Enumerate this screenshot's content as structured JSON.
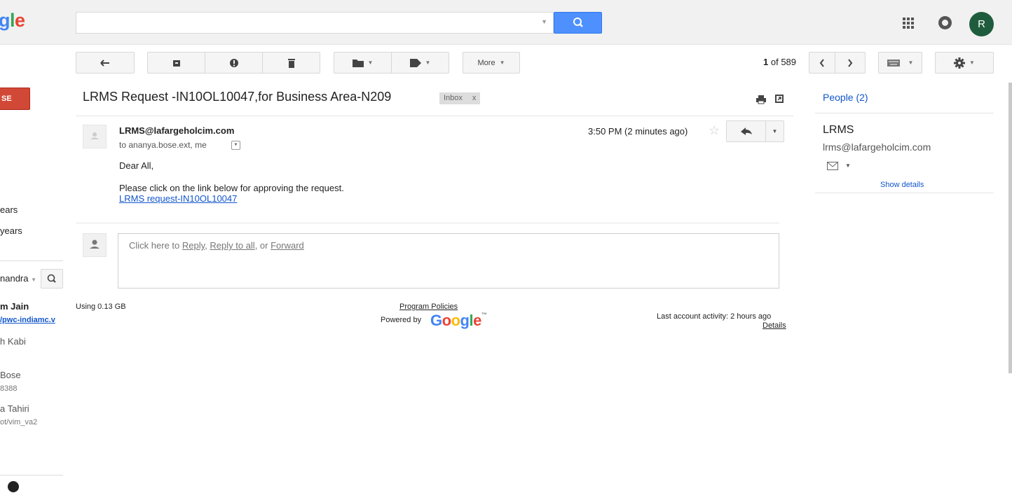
{
  "header": {
    "logo_fragments": [
      "g",
      "l",
      "e"
    ],
    "search_placeholder": "",
    "avatar_initial": "R"
  },
  "toolbar": {
    "more_label": "More",
    "pagination_current": "1",
    "pagination_total": "of 589"
  },
  "sidebar": {
    "compose_label": "SE",
    "label_1": "ears",
    "label_2": "years",
    "chat_search_value": "nandra",
    "chat_contacts": [
      {
        "name": "m Jain",
        "sub": "/pwc-indiamc.v"
      },
      {
        "name": "h Kabi",
        "sub": ""
      },
      {
        "name": " Bose",
        "sub": "8388"
      },
      {
        "name": "a Tahiri",
        "sub": "ot/vim_va2"
      }
    ]
  },
  "message": {
    "subject": "LRMS Request -IN10OL10047,for Business Area-N209",
    "label": "Inbox",
    "label_remove": "x",
    "sender": "LRMS@lafargeholcim.com",
    "to_line": "to ananya.bose.ext, me",
    "time": "3:50 PM (2 minutes ago)",
    "greeting": "Dear All,",
    "body_line": "Please click on the link below for approving the request.",
    "body_link": "LRMS request-IN10OL10047"
  },
  "reply_box": {
    "prefix": "Click here to ",
    "reply": "Reply",
    "sep1": ", ",
    "reply_all": "Reply to all",
    "sep2": ", or ",
    "forward": "Forward"
  },
  "footer": {
    "storage": "Using 0.13 GB",
    "policies": "Program Policies",
    "powered_by": "Powered by",
    "powered_logo": [
      "G",
      "o",
      "o",
      "g",
      "l",
      "e"
    ],
    "activity": "Last account activity: 2 hours ago",
    "details": "Details"
  },
  "people": {
    "title": "People (2)",
    "contact_name": "LRMS",
    "contact_email": "lrms@lafargeholcim.com",
    "show_details": "Show details"
  },
  "colors": {
    "compose": "#d14836",
    "search_button": "#4d90fe",
    "link": "#1155cc",
    "avatar": "#1f5c3d"
  }
}
